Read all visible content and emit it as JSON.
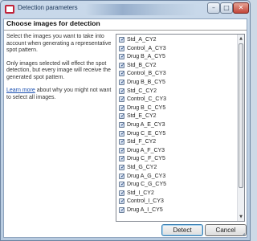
{
  "window": {
    "title": "Detection parameters",
    "controls": {
      "minimize": "–",
      "maximize": "□",
      "close": "✕"
    }
  },
  "header": {
    "title": "Choose images for detection"
  },
  "description": {
    "paragraph1": "Select the images you want to take into account when generating a representative spot pattern.",
    "paragraph2": "Only images selected will effect the spot detection, but every image will receive the generated spot pattern.",
    "learn_more_link": "Learn more",
    "learn_more_rest": " about why you might not want to select all images."
  },
  "image_list": {
    "items": [
      {
        "label": "Std_A_CY2",
        "checked": true
      },
      {
        "label": "Control_A_CY3",
        "checked": true
      },
      {
        "label": "Drug B_A_CY5",
        "checked": true
      },
      {
        "label": "Std_B_CY2",
        "checked": true
      },
      {
        "label": "Control_B_CY3",
        "checked": true
      },
      {
        "label": "Drug B_B_CY5",
        "checked": true
      },
      {
        "label": "Std_C_CY2",
        "checked": true
      },
      {
        "label": "Control_C_CY3",
        "checked": true
      },
      {
        "label": "Drug B_C_CY5",
        "checked": true
      },
      {
        "label": "Std_E_CY2",
        "checked": true
      },
      {
        "label": "Drug A_E_CY3",
        "checked": true
      },
      {
        "label": "Drug C_E_CY5",
        "checked": true
      },
      {
        "label": "Std_F_CY2",
        "checked": true
      },
      {
        "label": "Drug A_F_CY3",
        "checked": true
      },
      {
        "label": "Drug C_F_CY5",
        "checked": true
      },
      {
        "label": "Std_G_CY2",
        "checked": true
      },
      {
        "label": "Drug A_G_CY3",
        "checked": true
      },
      {
        "label": "Drug C_G_CY5",
        "checked": true
      },
      {
        "label": "Std_I_CY2",
        "checked": true
      },
      {
        "label": "Control_I_CY3",
        "checked": true
      },
      {
        "label": "Drug A_I_CY5",
        "checked": true
      }
    ]
  },
  "buttons": {
    "detect": "Detect",
    "cancel": "Cancel"
  },
  "icons": {
    "app": "app-icon",
    "checkbox_mark": "✓",
    "scroll_up": "▲",
    "scroll_down": "▼",
    "resize": "resize-grip-icon"
  },
  "colors": {
    "link": "#1a4fb0",
    "app_icon": "#c0233a"
  }
}
